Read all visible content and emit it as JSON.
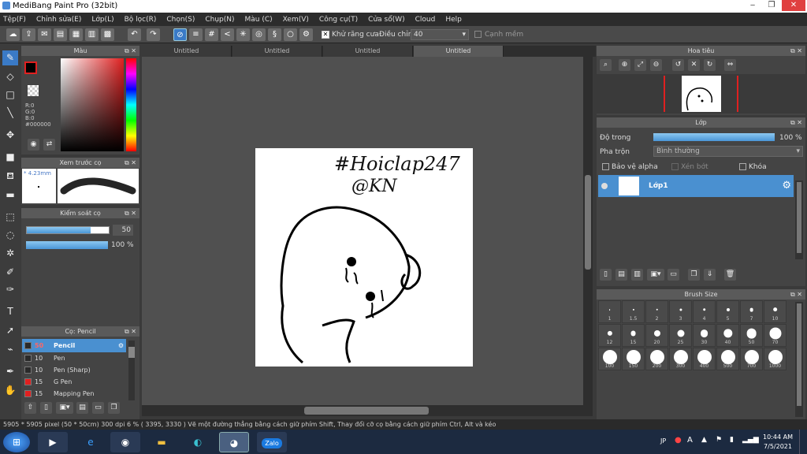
{
  "window": {
    "title": "MediBang Paint Pro (32bit)"
  },
  "menu": [
    "Tệp(F)",
    "Chỉnh sửa(E)",
    "Lớp(L)",
    "Bộ lọc(R)",
    "Chọn(S)",
    "Chụp(N)",
    "Màu (C)",
    "Xem(V)",
    "Công cụ(T)",
    "Cửa sổ(W)",
    "Cloud",
    "Help"
  ],
  "toolbar": {
    "antialias_label": "Khử răng cưa",
    "correction_label": "Điều chỉnh",
    "correction_value": "40",
    "edge_label": "Cạnh mềm"
  },
  "color_panel": {
    "title": "Màu",
    "r": "R:0",
    "g": "G:0",
    "b": "B:0",
    "hex": "#000000"
  },
  "preview_panel": {
    "title": "Xem trước cọ",
    "size": "4.23mm"
  },
  "control_panel": {
    "title": "Kiểm soát cọ",
    "size_value": "50",
    "opacity_value": "100 %",
    "size_fraction": 0.78,
    "opacity_fraction": 1.0
  },
  "brush_panel": {
    "title": "Cọ: Pencil",
    "items": [
      {
        "size": "50",
        "name": "Pencil",
        "color": "#2a2a2a",
        "selected": true
      },
      {
        "size": "10",
        "name": "Pen",
        "color": "#2a2a2a"
      },
      {
        "size": "10",
        "name": "Pen (Sharp)",
        "color": "#2a2a2a"
      },
      {
        "size": "15",
        "name": "G Pen",
        "color": "#e02020"
      },
      {
        "size": "15",
        "name": "Mapping Pen",
        "color": "#e02020"
      }
    ]
  },
  "tabs": [
    "Untitled",
    "Untitled",
    "Untitled",
    "Untitled"
  ],
  "canvas": {
    "text1": "#Hoiclap247",
    "text2": "@KN"
  },
  "navigator": {
    "title": "Hoa tiêu"
  },
  "layer_panel": {
    "title": "Lớp",
    "opacity_label": "Độ trong",
    "opacity_value": "100 %",
    "opacity_fraction": 1.0,
    "blend_label": "Pha trộn",
    "blend_value": "Bình thường",
    "protect_alpha": "Bảo vệ alpha",
    "clip": "Xén bớt",
    "lock": "Khóa",
    "layer_name": "Lớp1"
  },
  "brush_size": {
    "title": "Brush Size",
    "sizes": [
      "1",
      "1.5",
      "2",
      "3",
      "4",
      "5",
      "7",
      "10",
      "12",
      "15",
      "20",
      "25",
      "30",
      "40",
      "50",
      "70",
      "100",
      "150",
      "200",
      "300",
      "400",
      "500",
      "700",
      "1000"
    ]
  },
  "status": "5905 * 5905 pixel   (50 * 50cm)   300 dpi   6 %   ( 3395, 3330 )   Vẽ một đường thẳng bằng cách giữ phím Shift, Thay đổi cỡ cọ bằng cách giữ phím Ctrl, Alt và kéo",
  "taskbar": {
    "lang": "JP",
    "time": "10:44 AM",
    "date": "7/5/2021",
    "zalo": "Zalo"
  }
}
